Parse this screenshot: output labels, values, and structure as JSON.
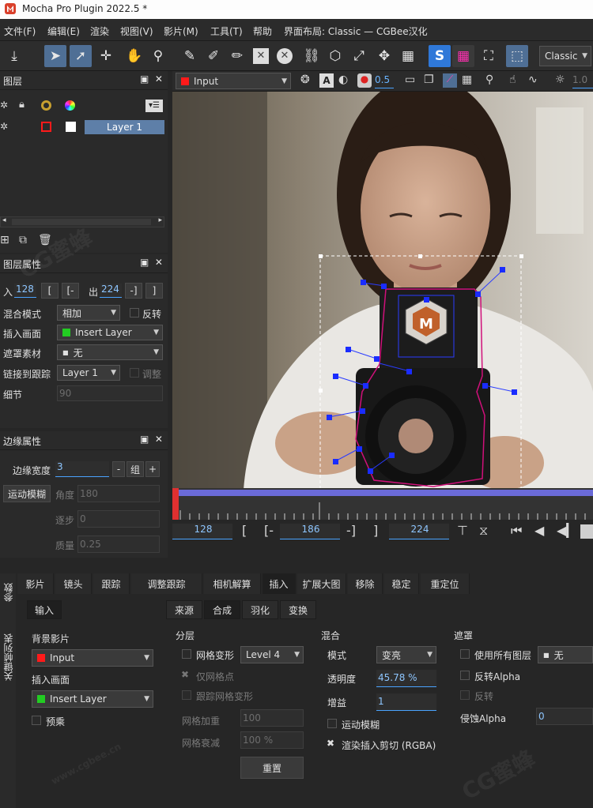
{
  "app": {
    "title": "Mocha Pro Plugin 2022.5 *"
  },
  "menu": {
    "items": [
      "文件(F)",
      "编辑(E)",
      "渲染",
      "视图(V)",
      "影片(M)",
      "工具(T)",
      "帮助"
    ],
    "layout_label": "界面布局: Classic — CGBee汉化"
  },
  "toolbar": {
    "layout_select": "Classic",
    "layer_select": "Input",
    "opacity_value": "0.5",
    "zoom_value": "1.0"
  },
  "layers_panel": {
    "title": "图层",
    "layer_name": "Layer 1"
  },
  "layer_props": {
    "title": "图层属性",
    "in_label": "入",
    "in_value": "128",
    "out_label": "出",
    "out_value": "224",
    "blend_label": "混合模式",
    "blend_value": "相加",
    "invert_label": "反转",
    "insert_label": "插入画面",
    "insert_value": "Insert Layer",
    "matte_label": "遮罩素材",
    "matte_value": "无",
    "link_label": "链接到跟踪",
    "link_value": "Layer 1",
    "adjust_label": "调整",
    "detail_label": "细节",
    "detail_value": "90"
  },
  "edge_props": {
    "title": "边缘属性",
    "edge_width_label": "边缘宽度",
    "edge_width_value": "3",
    "group_label": "组",
    "motion_blur_btn": "运动模糊",
    "angle_label": "角度",
    "angle_value": "180",
    "phase_label": "逐步",
    "phase_value": "0",
    "quality_label": "质量",
    "quality_value": "0.25"
  },
  "timeline": {
    "in_value": "128",
    "current_value": "186",
    "out_value": "224"
  },
  "lower": {
    "side_tabs": [
      "参数",
      "关键帧列表"
    ],
    "tabs": [
      "影片",
      "镜头",
      "跟踪",
      "调整跟踪",
      "相机解算",
      "插入",
      "扩展大图",
      "移除",
      "稳定",
      "重定位"
    ],
    "active_tab": "插入",
    "input_tab": "输入",
    "bg_clip_label": "背景影片",
    "bg_clip_value": "Input",
    "insert_label": "插入画面",
    "insert_value": "Insert Layer",
    "premult_label": "预乘",
    "subtabs": [
      "来源",
      "合成",
      "羽化",
      "变换"
    ],
    "layering": {
      "title": "分层",
      "mesh_warp": "网格变形",
      "mesh_level": "Level 4",
      "mesh_points": "仅网格点",
      "track_mesh": "跟踪网格变形",
      "mesh_add": "网格加重",
      "mesh_add_value": "100",
      "mesh_decay": "网格衰减",
      "mesh_decay_value": "100 %",
      "reset": "重置"
    },
    "blend": {
      "title": "混合",
      "mode_label": "模式",
      "mode_value": "变亮",
      "opacity_label": "透明度",
      "opacity_value": "45.78 %",
      "gain_label": "增益",
      "gain_value": "1",
      "motion_blur": "运动模糊",
      "render_cut": "渲染插入剪切 (RGBA)"
    },
    "matte": {
      "title": "遮罩",
      "use_all": "使用所有图层",
      "use_all_value": "无",
      "invert_alpha": "反转Alpha",
      "invert": "反转",
      "erode_label": "侵蚀Alpha",
      "erode_value": "0"
    }
  },
  "watermark": {
    "text": "CG蜜蜂",
    "url": "www.cgbee.cn"
  },
  "colors": {
    "accent": "#4aa3ff",
    "red": "#ff1a1a",
    "green": "#22cc22",
    "layer_row": "#5e7fa8"
  }
}
